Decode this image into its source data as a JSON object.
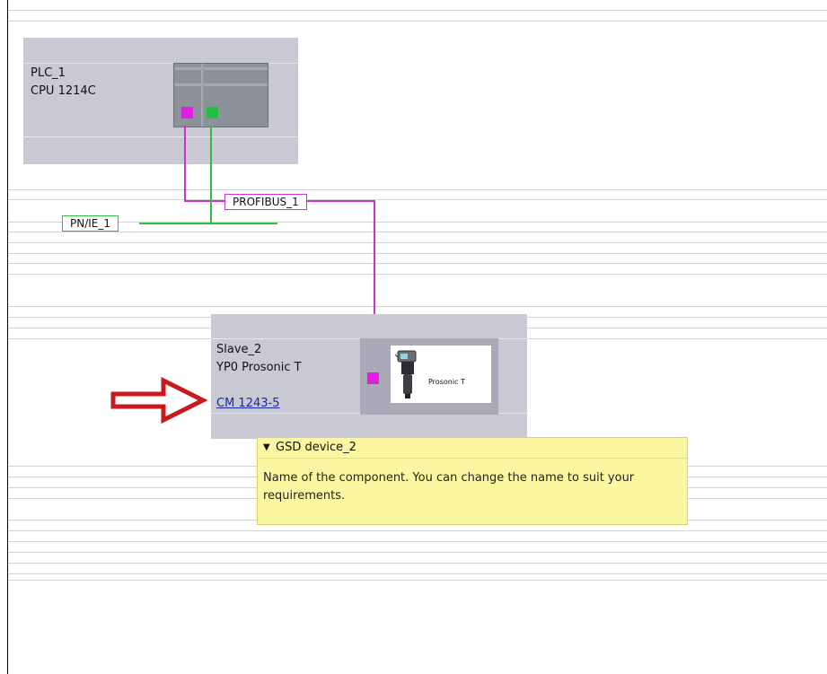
{
  "plc": {
    "name": "PLC_1",
    "type": "CPU 1214C"
  },
  "networks": {
    "profibus_label": "PROFIBUS_1",
    "profinet_label": "PN/IE_1"
  },
  "slave": {
    "name": "Slave_2",
    "model": "YP0 Prosonic T",
    "module_link": "CM 1243-5",
    "image_caption": "Prosonic T"
  },
  "tooltip": {
    "title": "GSD device_2",
    "text": "Name of the component. You can change the name to suit your requirements."
  },
  "colors": {
    "profibus": "#cc33cc",
    "profinet": "#33bb44",
    "pointer_arrow": "#c8191f"
  }
}
